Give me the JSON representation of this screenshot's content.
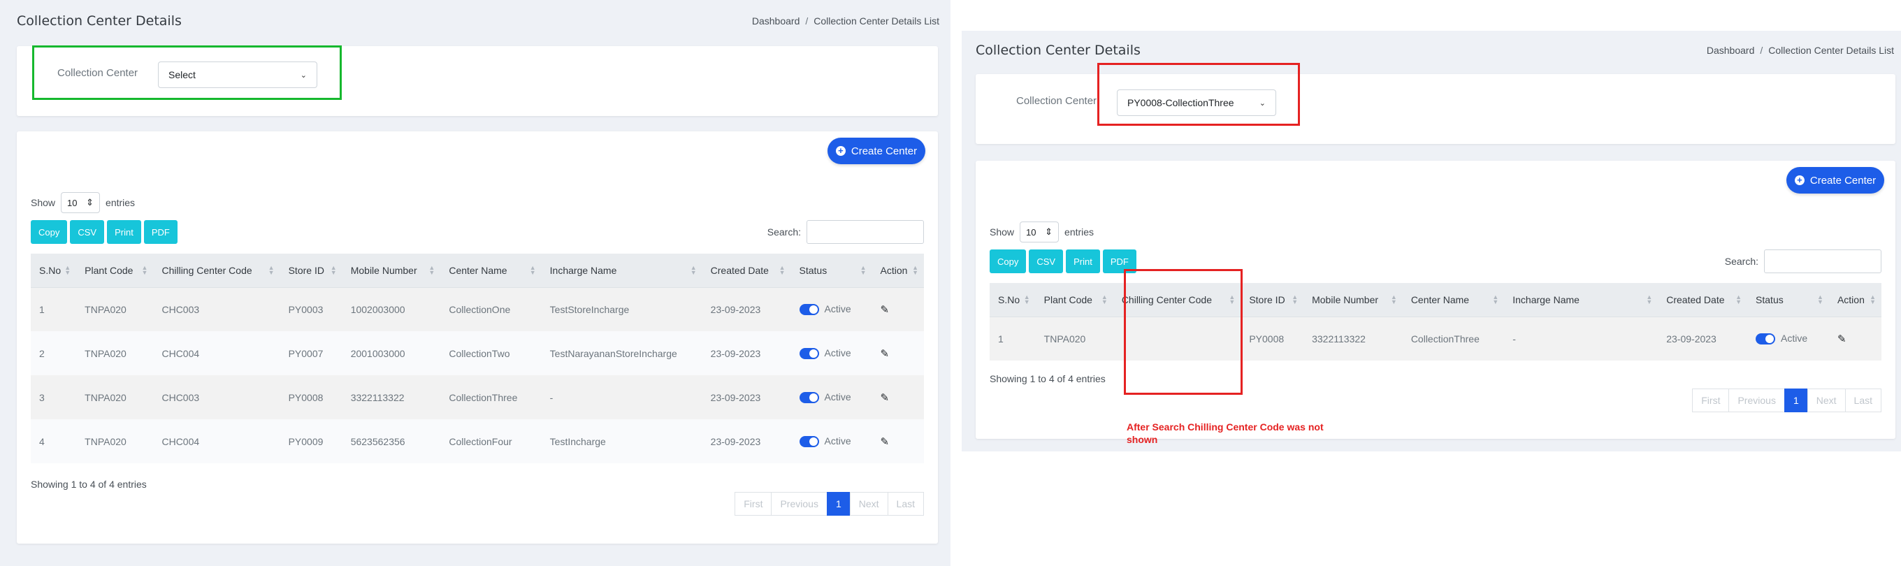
{
  "left": {
    "title": "Collection Center Details",
    "breadcrumb": [
      "Dashboard",
      "Collection Center Details List"
    ],
    "filter": {
      "label": "Collection Center",
      "selected": "Select"
    },
    "create_label": "Create Center",
    "length": {
      "show": "Show",
      "value": "10",
      "entries": "entries"
    },
    "export_buttons": [
      "Copy",
      "CSV",
      "Print",
      "PDF"
    ],
    "search_label": "Search:",
    "columns": [
      "S.No",
      "Plant Code",
      "Chilling Center Code",
      "Store ID",
      "Mobile Number",
      "Center Name",
      "Incharge Name",
      "Created Date",
      "Status",
      "Action"
    ],
    "rows": [
      [
        "1",
        "TNPA020",
        "CHC003",
        "PY0003",
        "1002003000",
        "CollectionOne",
        "TestStoreIncharge",
        "23-09-2023",
        "Active"
      ],
      [
        "2",
        "TNPA020",
        "CHC004",
        "PY0007",
        "2001003000",
        "CollectionTwo",
        "TestNarayananStoreIncharge",
        "23-09-2023",
        "Active"
      ],
      [
        "3",
        "TNPA020",
        "CHC003",
        "PY0008",
        "3322113322",
        "CollectionThree",
        "-",
        "23-09-2023",
        "Active"
      ],
      [
        "4",
        "TNPA020",
        "CHC004",
        "PY0009",
        "5623562356",
        "CollectionFour",
        "TestIncharge",
        "23-09-2023",
        "Active"
      ]
    ],
    "info": "Showing 1 to 4 of 4 entries",
    "pager": [
      "First",
      "Previous",
      "1",
      "Next",
      "Last"
    ]
  },
  "right": {
    "title": "Collection Center Details",
    "breadcrumb": [
      "Dashboard",
      "Collection Center Details List"
    ],
    "filter": {
      "label": "Collection Center",
      "selected": "PY0008-CollectionThree"
    },
    "create_label": "Create Center",
    "length": {
      "show": "Show",
      "value": "10",
      "entries": "entries"
    },
    "export_buttons": [
      "Copy",
      "CSV",
      "Print",
      "PDF"
    ],
    "search_label": "Search:",
    "columns": [
      "S.No",
      "Plant Code",
      "Chilling Center Code",
      "Store ID",
      "Mobile Number",
      "Center Name",
      "Incharge Name",
      "Created Date",
      "Status",
      "Action"
    ],
    "rows": [
      [
        "1",
        "TNPA020",
        "",
        "PY0008",
        "3322113322",
        "CollectionThree",
        "-",
        "23-09-2023",
        "Active"
      ]
    ],
    "info": "Showing 1 to 4 of 4 entries",
    "pager": [
      "First",
      "Previous",
      "1",
      "Next",
      "Last"
    ],
    "annotation": "After Search Chilling Center Code was not shown"
  },
  "colors": {
    "accent": "#1d5de8",
    "export": "#17c5da",
    "highlight_green": "#16b82e",
    "highlight_red": "#e52222"
  },
  "icons": {
    "create": "plus-circle-icon",
    "action": "pencil-icon",
    "sort": "sort-arrows-icon",
    "select": "chevron-up-down-icon"
  }
}
